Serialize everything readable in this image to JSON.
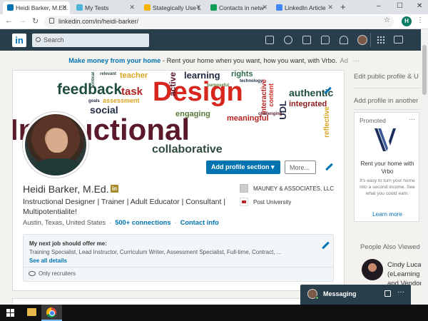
{
  "browser": {
    "tabs": [
      {
        "title": "Heidi Barker, M.Ed.",
        "favicon_color": "#0073b1",
        "active": true
      },
      {
        "title": "My Tests",
        "favicon_color": "#4db6d8",
        "active": false
      },
      {
        "title": "Stategically Use L",
        "favicon_color": "#f4b400",
        "active": false
      },
      {
        "title": "Contacts in netw",
        "favicon_color": "#0f9d58",
        "active": false
      },
      {
        "title": "LinkedIn Article",
        "favicon_color": "#4285f4",
        "active": false
      }
    ],
    "new_tab": "+",
    "window_controls": [
      "–",
      "☐",
      "✕"
    ],
    "url": "linkedin.com/in/heidi-barker/",
    "profile_initial": "H"
  },
  "linkedin_nav": {
    "logo": "in",
    "search_placeholder": "Search",
    "icons": [
      "home-icon",
      "my-network-icon",
      "jobs-icon",
      "messaging-icon",
      "notifications-icon",
      "me-avatar",
      "work-grid-icon",
      "learning-icon"
    ]
  },
  "ad": {
    "link_text": "Make money from your home",
    "text": " - Rent your home when you want, how you want, with Vrbo.",
    "tag": "Ad",
    "dots": "···"
  },
  "banner_words": [
    {
      "text": "feedback",
      "color": "#1f4e3d"
    },
    {
      "text": "task",
      "color": "#b22222"
    },
    {
      "text": "teacher",
      "color": "#d9a520"
    },
    {
      "text": "Design",
      "color": "#d7261e"
    },
    {
      "text": "learning",
      "color": "#1f2a44"
    },
    {
      "text": "rights",
      "color": "#2e6b4b"
    },
    {
      "text": "authentic",
      "color": "#1f4e3d"
    },
    {
      "text": "integrated",
      "color": "#8a1c1c"
    },
    {
      "text": "social",
      "color": "#1f2a44"
    },
    {
      "text": "assessment",
      "color": "#d9a520"
    },
    {
      "text": "engaging",
      "color": "#5a7a3a"
    },
    {
      "text": "meaningful",
      "color": "#b22222"
    },
    {
      "text": "Instructional",
      "color": "#5a1a2a"
    },
    {
      "text": "collaborative",
      "color": "#2e4b3b"
    },
    {
      "text": "interactive",
      "color": "#b22222"
    },
    {
      "text": "content",
      "color": "#d7261e"
    },
    {
      "text": "UDL",
      "color": "#1f2a44"
    },
    {
      "text": "reflective",
      "color": "#d9a520"
    },
    {
      "text": "relevant",
      "color": "#2e4b3b"
    },
    {
      "text": "purposeful",
      "color": "#5a7a3a"
    },
    {
      "text": "challenging",
      "color": "#5a1a2a"
    },
    {
      "text": "technology",
      "color": "#1f2a44"
    },
    {
      "text": "goals",
      "color": "#1f2a44"
    },
    {
      "text": "active",
      "color": "#5a1a2a"
    },
    {
      "text": "critical",
      "color": "#1f4e3d"
    }
  ],
  "profile": {
    "add_section_label": "Add profile section",
    "add_section_caret": "▾",
    "more_label": "More...",
    "name": "Heidi Barker, M.Ed.",
    "in_badge": "in",
    "headline": "Instructional Designer | Trainer | Adult Educator | Consultant | Multipotentialite!",
    "location": "Austin, Texas, United States",
    "connections": "500+ connections",
    "contact_info": "Contact info",
    "dot": "·",
    "company": "MAUNEY & ASSOCIATES, LLC",
    "school": "Post University",
    "job": {
      "title": "My next job should offer me:",
      "list": "Training Specialist, Lead Instructor, Curriculum Writer, Assessment Specialist, Full-time, Contract, ...",
      "details_link": "See all details",
      "visibility": "Only recruiters"
    }
  },
  "rail": {
    "edit_public": "Edit public profile & U",
    "add_language": "Add profile in another",
    "promo": {
      "label": "Promoted",
      "dots": "···",
      "title": "Rent your home with Vrbo",
      "body": "It's easy to turn your home into a second income. See what you could earn.",
      "cta": "Learn more"
    },
    "people_also_viewed": "People Also Viewed",
    "person": {
      "name_line1": "Cindy Lucas",
      "name_line2": "(eLearning",
      "name_line3": "and Vendor"
    }
  },
  "messaging": {
    "label": "Messaging",
    "dots": "···"
  },
  "colors": {
    "linkedin_blue": "#0073b1",
    "linkedin_nav": "#283e4a",
    "page_bg": "#f3f2ef",
    "taskbar": "#101010"
  }
}
